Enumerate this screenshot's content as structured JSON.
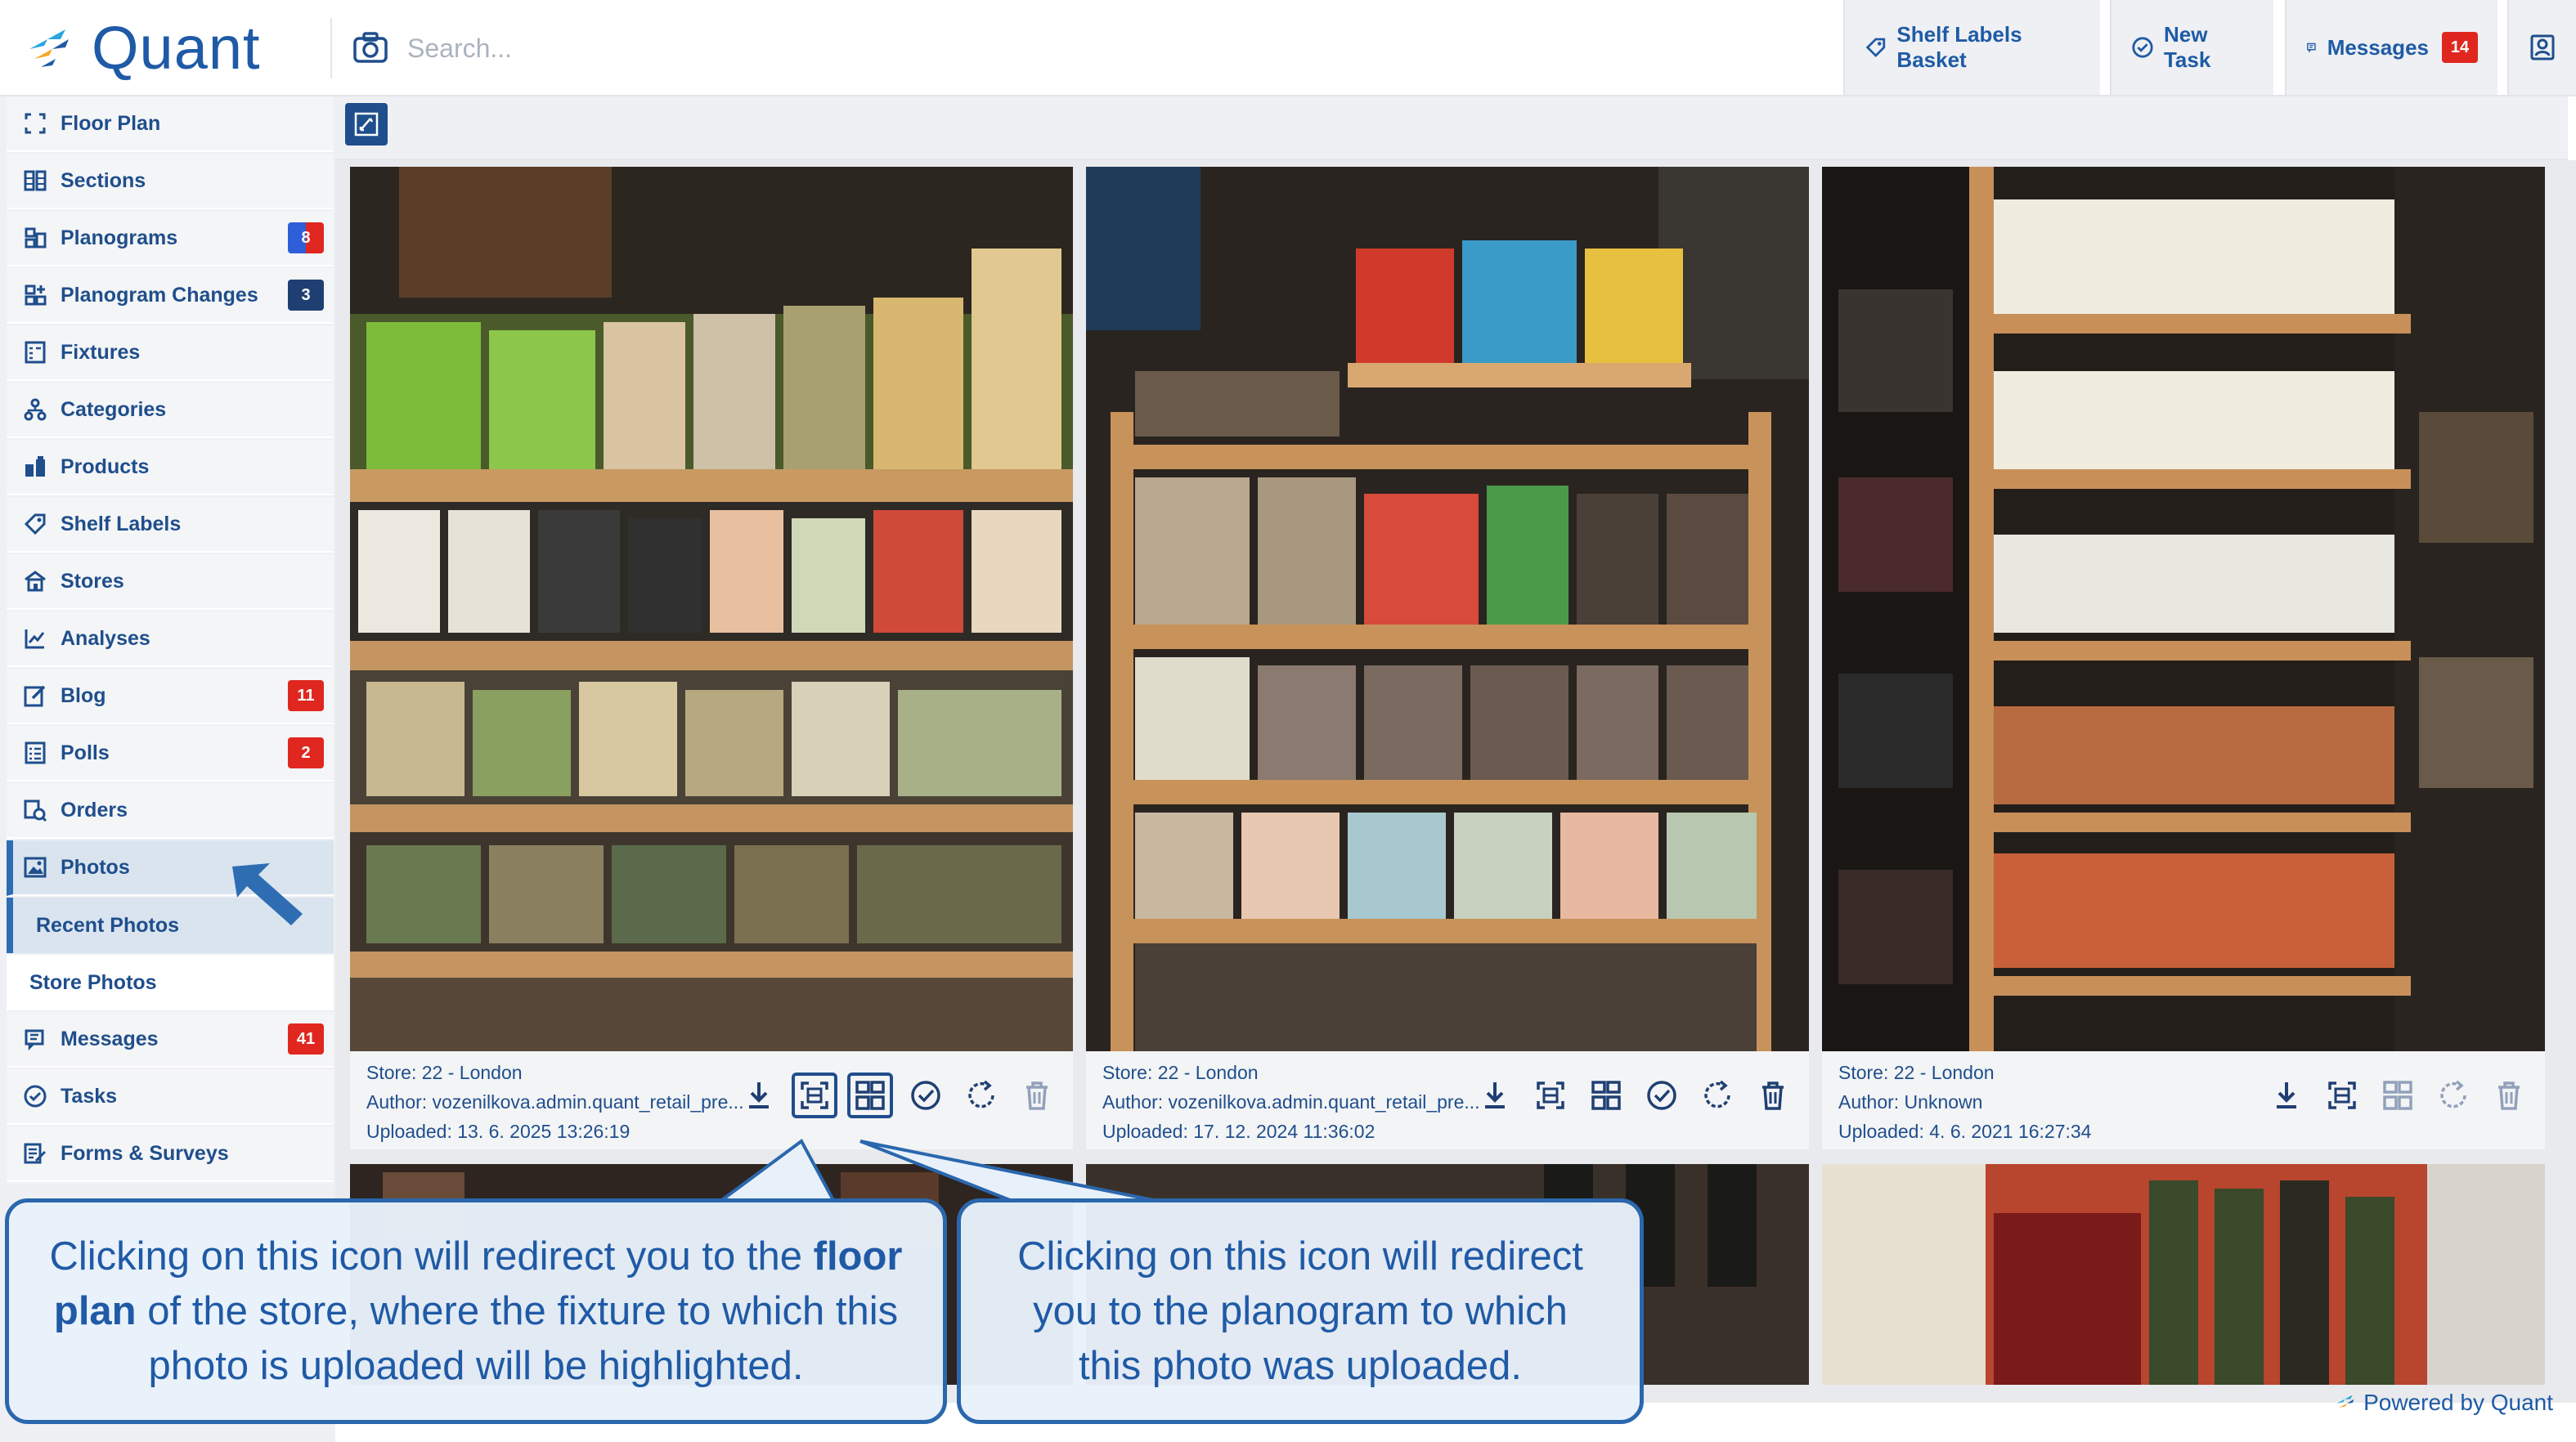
{
  "app": {
    "name": "Quant",
    "footer": "Powered by Quant"
  },
  "search": {
    "placeholder": "Search..."
  },
  "header": {
    "shelf_labels_basket": "Shelf Labels Basket",
    "new_task": "New Task",
    "messages": "Messages",
    "messages_count": "14"
  },
  "sidebar": {
    "items": [
      {
        "label": "Floor Plan",
        "icon": "floor-plan-icon"
      },
      {
        "label": "Sections",
        "icon": "sections-icon"
      },
      {
        "label": "Planograms",
        "icon": "planograms-icon",
        "badge": "8"
      },
      {
        "label": "Planogram Changes",
        "icon": "planogram-changes-icon",
        "badge": "3"
      },
      {
        "label": "Fixtures",
        "icon": "fixtures-icon"
      },
      {
        "label": "Categories",
        "icon": "categories-icon"
      },
      {
        "label": "Products",
        "icon": "products-icon"
      },
      {
        "label": "Shelf Labels",
        "icon": "tag-icon"
      },
      {
        "label": "Stores",
        "icon": "store-icon"
      },
      {
        "label": "Analyses",
        "icon": "analyses-icon"
      },
      {
        "label": "Blog",
        "icon": "blog-icon",
        "badge": "11"
      },
      {
        "label": "Polls",
        "icon": "polls-icon",
        "badge": "2"
      },
      {
        "label": "Orders",
        "icon": "orders-icon"
      },
      {
        "label": "Photos",
        "icon": "image-icon"
      },
      {
        "label": "Recent Photos"
      },
      {
        "label": "Store Photos"
      },
      {
        "label": "Messages",
        "icon": "messages-icon",
        "badge": "41"
      },
      {
        "label": "Tasks",
        "icon": "tasks-icon"
      },
      {
        "label": "Forms & Surveys",
        "icon": "forms-icon"
      }
    ]
  },
  "photos": [
    {
      "store": "Store: 22 - London",
      "author": "Author: vozenilkova.admin.quant_retail_pre...",
      "uploaded": "Uploaded: 13. 6. 2025 13:26:19"
    },
    {
      "store": "Store: 22 - London",
      "author": "Author: vozenilkova.admin.quant_retail_pre...",
      "uploaded": "Uploaded: 17. 12. 2024 11:36:02"
    },
    {
      "store": "Store: 22 - London",
      "author": "Author: Unknown",
      "uploaded": "Uploaded: 4. 6. 2021 16:27:34"
    }
  ],
  "callouts": {
    "left": {
      "pre": "Clicking on this icon will redirect you to the ",
      "bold1": "floor plan",
      "mid": " of the store, where the fixture to which this photo is uploaded will be highlighted."
    },
    "right": {
      "text": "Clicking on this icon will redirect you to the planogram to which this photo was uploaded."
    }
  },
  "colors": {
    "brand": "#1f5aa6",
    "badge_red": "#e0271f",
    "badge_dark": "#1f3f73",
    "callout_border": "#2a67ad"
  }
}
